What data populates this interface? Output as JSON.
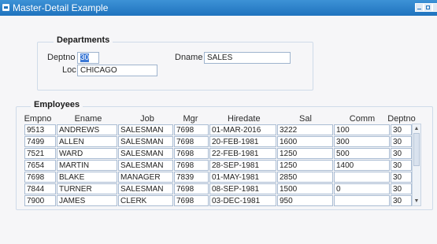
{
  "window": {
    "title": "Master-Detail Example"
  },
  "departments": {
    "section_title": "Departments",
    "deptno_label": "Deptno",
    "deptno_value": "30",
    "dname_label": "Dname",
    "dname_value": "SALES",
    "loc_label": "Loc",
    "loc_value": "CHICAGO"
  },
  "employees": {
    "section_title": "Employees",
    "columns": [
      "Empno",
      "Ename",
      "Job",
      "Mgr",
      "Hiredate",
      "Sal",
      "Comm",
      "Deptno"
    ],
    "rows": [
      [
        "9513",
        "ANDREWS",
        "SALESMAN",
        "7698",
        "01-MAR-2016",
        "3222",
        "100",
        "30"
      ],
      [
        "7499",
        "ALLEN",
        "SALESMAN",
        "7698",
        "20-FEB-1981",
        "1600",
        "300",
        "30"
      ],
      [
        "7521",
        "WARD",
        "SALESMAN",
        "7698",
        "22-FEB-1981",
        "1250",
        "500",
        "30"
      ],
      [
        "7654",
        "MARTIN",
        "SALESMAN",
        "7698",
        "28-SEP-1981",
        "1250",
        "1400",
        "30"
      ],
      [
        "7698",
        "BLAKE",
        "MANAGER",
        "7839",
        "01-MAY-1981",
        "2850",
        "",
        "30"
      ],
      [
        "7844",
        "TURNER",
        "SALESMAN",
        "7698",
        "08-SEP-1981",
        "1500",
        "0",
        "30"
      ],
      [
        "7900",
        "JAMES",
        "CLERK",
        "7698",
        "03-DEC-1981",
        "950",
        "",
        "30"
      ]
    ]
  },
  "colors": {
    "titlebar": "#1f73be",
    "selection": "#3d7ad6",
    "field_border": "#9fb4ce"
  }
}
